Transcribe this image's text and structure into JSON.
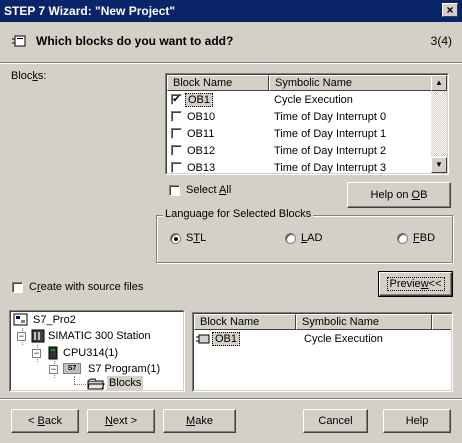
{
  "window": {
    "title": "STEP 7 Wizard: \"New Project\"",
    "close_label": "×"
  },
  "header": {
    "question": "Which blocks do you want to add?",
    "step": "3(4)",
    "icon": "block-module-icon"
  },
  "blocks": {
    "label_pre": "Bloc",
    "label_u": "k",
    "label_post": "s:",
    "columns": [
      "Block Name",
      "Symbolic Name"
    ],
    "rows": [
      {
        "name": "OB1",
        "symbolic": "Cycle Execution",
        "checked": true
      },
      {
        "name": "OB10",
        "symbolic": "Time of Day Interrupt 0",
        "checked": false
      },
      {
        "name": "OB11",
        "symbolic": "Time of Day Interrupt 1",
        "checked": false
      },
      {
        "name": "OB12",
        "symbolic": "Time of Day Interrupt 2",
        "checked": false
      },
      {
        "name": "OB13",
        "symbolic": "Time of Day Interrupt 3",
        "checked": false
      }
    ],
    "check_mark": "✔"
  },
  "select_all": {
    "pre": "Select ",
    "u": "A",
    "post": "ll"
  },
  "help_ob": {
    "pre": "Help on ",
    "u": "O",
    "post": "B"
  },
  "language": {
    "legend": "Language for Selected Blocks",
    "options": [
      {
        "pre": "S",
        "u": "T",
        "post": "L",
        "selected": true
      },
      {
        "pre": "",
        "u": "L",
        "post": "AD",
        "selected": false
      },
      {
        "pre": "",
        "u": "F",
        "post": "BD",
        "selected": false
      }
    ]
  },
  "create_source": {
    "pre": "C",
    "u": "r",
    "post": "eate with source files"
  },
  "preview_label": {
    "pre": "Previe",
    "u": "w",
    "post": "<<"
  },
  "tree": {
    "items": [
      {
        "label": "S7_Pro2",
        "icon": "project-icon"
      },
      {
        "label": "SIMATIC 300 Station",
        "icon": "station-icon"
      },
      {
        "label": "CPU314(1)",
        "icon": "cpu-icon"
      },
      {
        "label": "S7 Program(1)",
        "icon": "s7-program-icon"
      },
      {
        "label": "Blocks",
        "icon": "folder-icon"
      }
    ],
    "expander_minus": "−",
    "s7_badge": "S7"
  },
  "preview_list": {
    "columns": [
      "Block Name",
      "Symbolic Name"
    ],
    "rows": [
      {
        "name": "OB1",
        "symbolic": "Cycle Execution"
      }
    ]
  },
  "buttons": {
    "back": {
      "pre": "< ",
      "u": "B",
      "post": "ack"
    },
    "next": {
      "pre": "",
      "u": "N",
      "post": "ext >"
    },
    "make": {
      "pre": "",
      "u": "M",
      "post": "ake"
    },
    "cancel": "Cancel",
    "help": "Help"
  }
}
